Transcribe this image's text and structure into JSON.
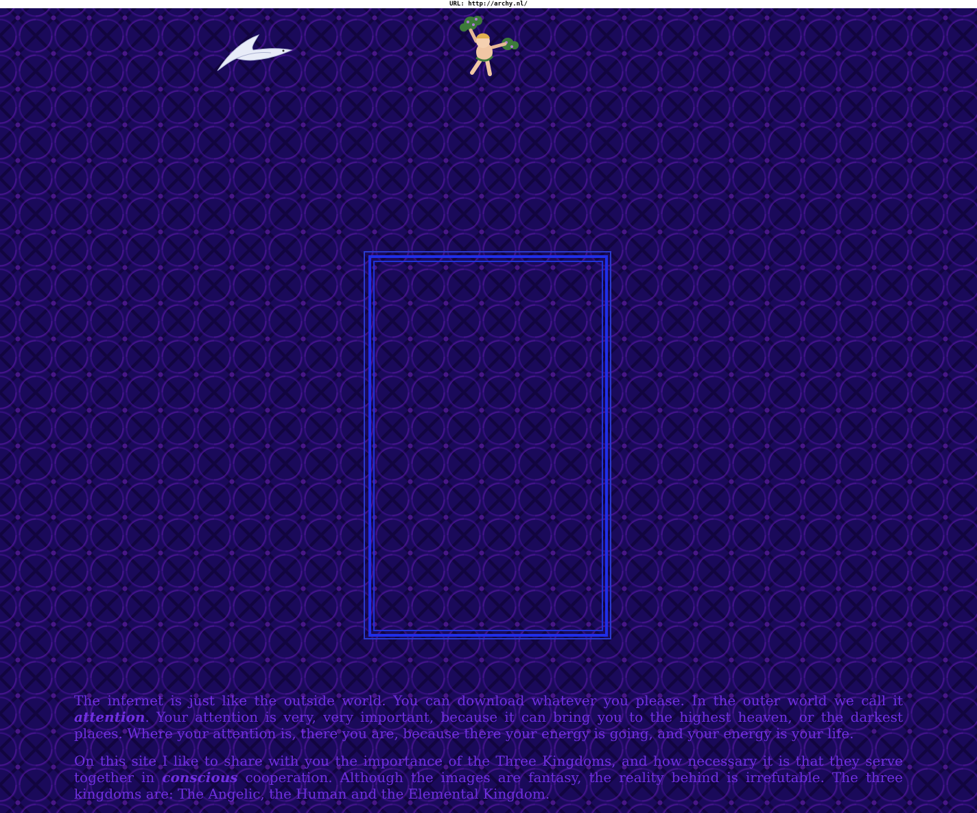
{
  "url_bar": {
    "label": "URL:",
    "url": "http://archy.nl/"
  },
  "colors": {
    "background": "#1a0a5a",
    "pattern": "#6e1ec0",
    "text": "#7030e0",
    "frame": "#1f2ee8"
  },
  "images": {
    "dove": "dove-icon",
    "cherub": "cherub-icon",
    "frame": "empty-frame"
  },
  "intro": {
    "p1_a": "The internet is just like the outside world. You can download whatever you please. In the outer world we call it ",
    "p1_em": "attention",
    "p1_b": ". Your attention is very, very important, because it can bring you to the highest heaven, or the darkest places. Where your attention is, there you are, because there your energy is going, and your energy is your life.",
    "p2_a": "On this site I like to share with you the importance of the Three Kingdoms, and how necessary it is that they serve together in ",
    "p2_em": "conscious",
    "p2_b": " cooperation. Although the images are fantasy, the reality behind is irrefutable. The three kingdoms are: The Angelic, the Human and the Elemental Kingdom."
  }
}
